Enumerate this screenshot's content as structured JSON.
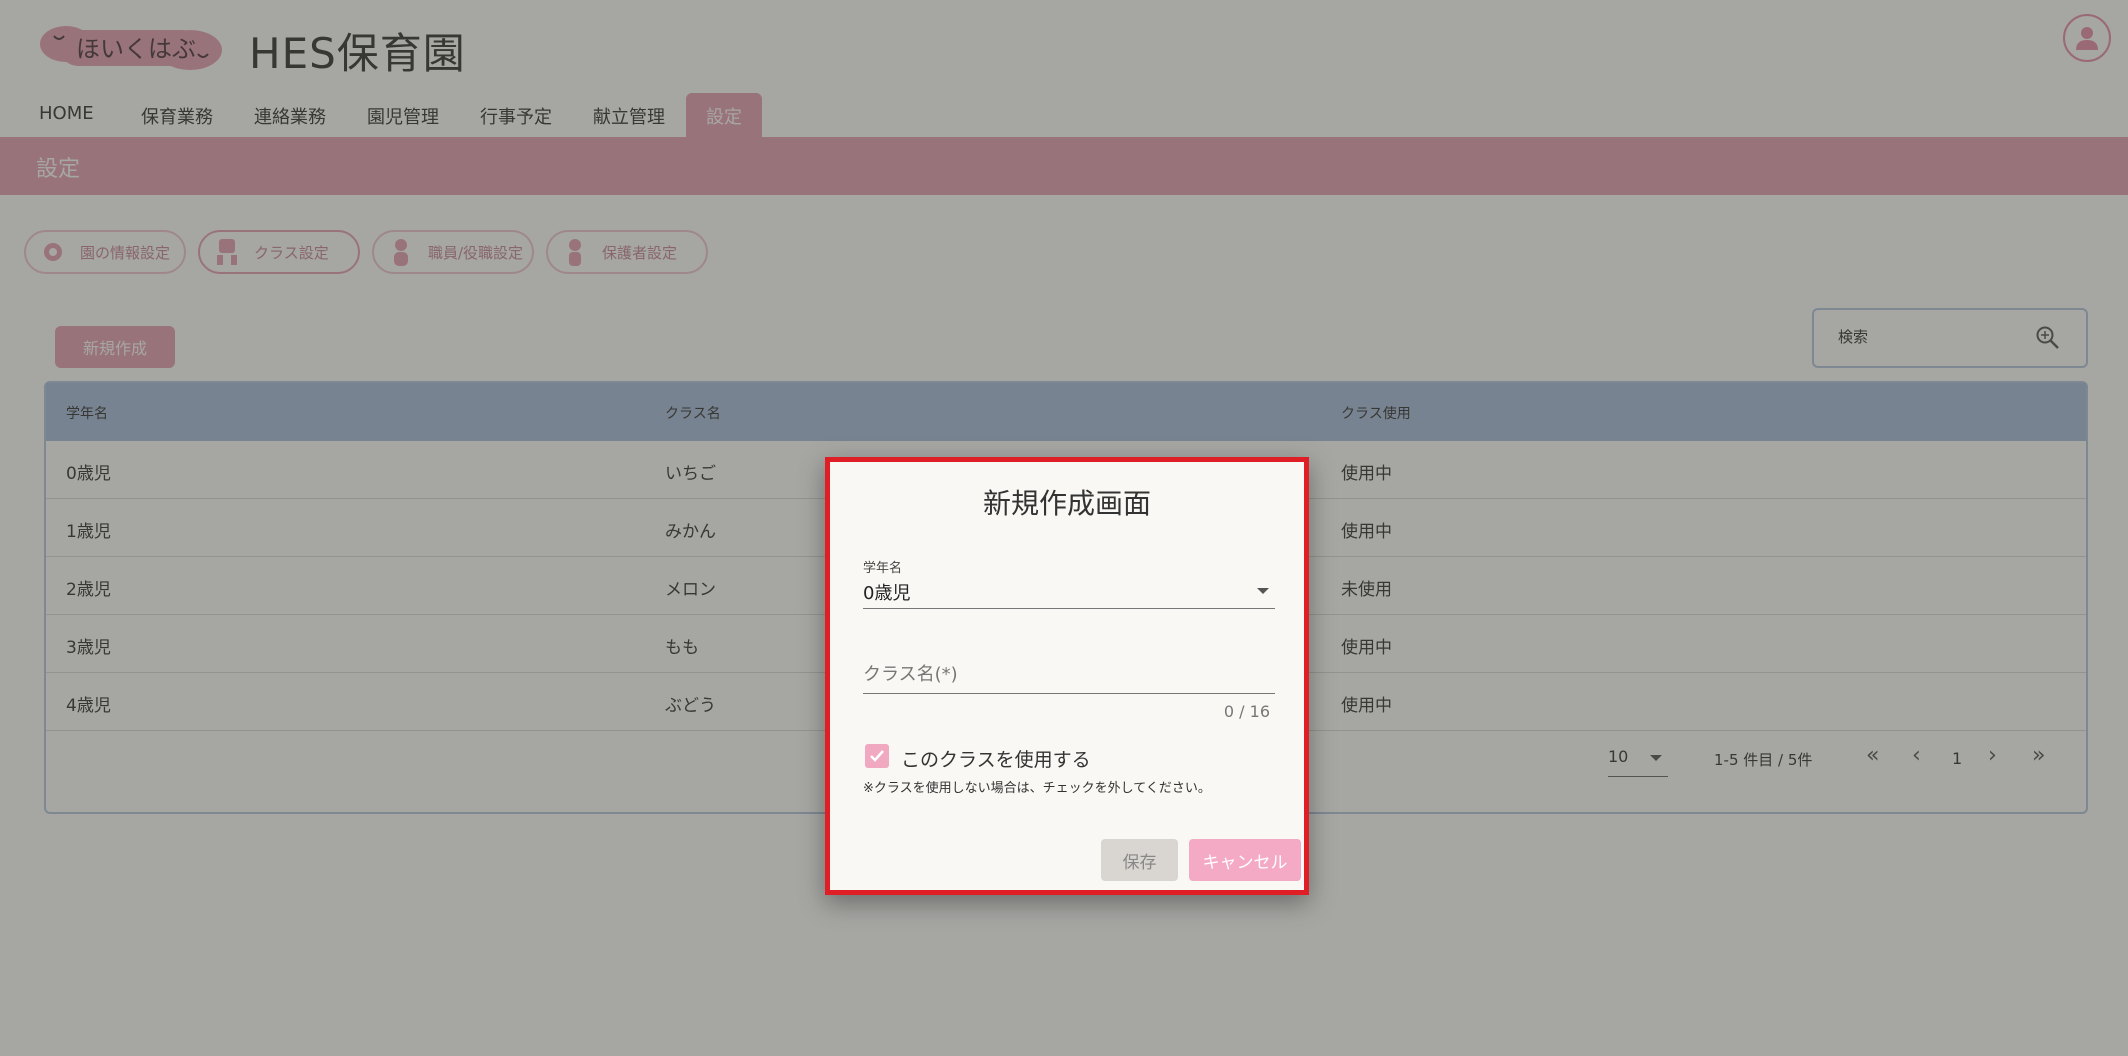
{
  "header": {
    "logo_text": "ほいくはぶ",
    "site_title": "HES保育園"
  },
  "nav": {
    "items": [
      {
        "label": "HOME"
      },
      {
        "label": "保育業務"
      },
      {
        "label": "連絡業務"
      },
      {
        "label": "園児管理"
      },
      {
        "label": "行事予定"
      },
      {
        "label": "献立管理"
      },
      {
        "label": "設定"
      }
    ],
    "active": "設定"
  },
  "section": {
    "title": "設定"
  },
  "sub_nav": {
    "items": [
      {
        "label": "園の情報設定",
        "icon": "gear-icon"
      },
      {
        "label": "クラス設定",
        "icon": "class-icon"
      },
      {
        "label": "職員/役職設定",
        "icon": "staff-icon"
      },
      {
        "label": "保護者設定",
        "icon": "guardian-icon"
      }
    ],
    "active": "クラス設定"
  },
  "toolbar": {
    "new_label": "新規作成",
    "search_placeholder": "検索"
  },
  "table": {
    "headers": [
      "学年名",
      "クラス名",
      "クラス使用"
    ],
    "rows": [
      {
        "grade": "0歳児",
        "class": "いちご",
        "usage": "使用中"
      },
      {
        "grade": "1歳児",
        "class": "みかん",
        "usage": "使用中"
      },
      {
        "grade": "2歳児",
        "class": "メロン",
        "usage": "未使用"
      },
      {
        "grade": "3歳児",
        "class": "もも",
        "usage": "使用中"
      },
      {
        "grade": "4歳児",
        "class": "ぶどう",
        "usage": "使用中"
      }
    ]
  },
  "pager": {
    "per_page": "10",
    "count_text": "1-5 件目 / 5件",
    "current_page": "1",
    "first": "«",
    "prev": "‹",
    "next": "›",
    "last": "»"
  },
  "dialog": {
    "title": "新規作成画面",
    "grade_label": "学年名",
    "grade_value": "0歳児",
    "class_name_placeholder": "クラス名(*)",
    "counter": "0 / 16",
    "checkbox_label": "このクラスを使用する",
    "checkbox_checked": true,
    "note": "※クラスを使用しない場合は、チェックを外してください。",
    "save_label": "保存",
    "cancel_label": "キャンセル"
  },
  "colors": {
    "accent_pink": "#e7a2b3",
    "table_header": "#a9bfdc",
    "dialog_border": "#e01e26",
    "cancel_button": "#f4a9c4"
  }
}
